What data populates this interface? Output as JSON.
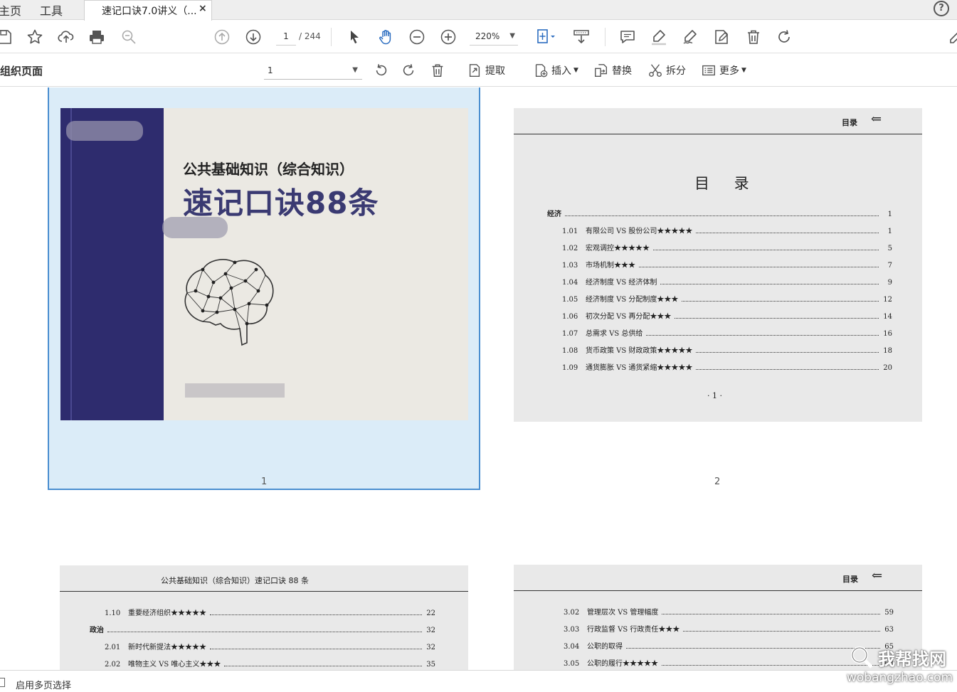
{
  "tabbar": {
    "home_label": "主页",
    "tools_label": "工具",
    "doc_tab_title": "速记口诀7.0讲义（...",
    "close_glyph": "×",
    "help_glyph": "?"
  },
  "toolbar": {
    "current_page": "1",
    "page_total": "/ 244",
    "zoom": "220%",
    "icons": [
      "save-icon",
      "star-icon",
      "upload-icon",
      "print-icon",
      "zoom-out-magnifier-icon",
      "page-up-icon",
      "page-down-icon",
      "select-cursor-icon",
      "hand-icon",
      "zoom-minus-icon",
      "zoom-plus-icon",
      "fit-page-icon",
      "scroll-mode-icon",
      "comment-icon",
      "highlight-icon",
      "sign-icon",
      "edit-page-icon",
      "delete-icon",
      "rotate-icon"
    ]
  },
  "organize": {
    "title": "组织页面",
    "page_select": "1",
    "extract": "提取",
    "insert": "插入",
    "replace": "替换",
    "split": "拆分",
    "more": "更多"
  },
  "pages": {
    "p1_number": "1",
    "p2_number": "2",
    "cover": {
      "subtitle": "公共基础知识（综合知识）",
      "title": "速记口诀88条"
    },
    "toc2": {
      "header": "目录",
      "title": "目 录",
      "section": "经济",
      "section_page": "1",
      "entries": [
        {
          "num": "1.01",
          "text": "有限公司 VS 股份公司★★★★★",
          "page": "1"
        },
        {
          "num": "1.02",
          "text": "宏观调控★★★★★",
          "page": "5"
        },
        {
          "num": "1.03",
          "text": "市场机制★★★",
          "page": "7"
        },
        {
          "num": "1.04",
          "text": "经济制度 VS 经济体制",
          "page": "9"
        },
        {
          "num": "1.05",
          "text": "经济制度 VS 分配制度★★★",
          "page": "12"
        },
        {
          "num": "1.06",
          "text": "初次分配 VS 再分配★★★",
          "page": "14"
        },
        {
          "num": "1.07",
          "text": "总需求 VS 总供给",
          "page": "16"
        },
        {
          "num": "1.08",
          "text": "货币政策 VS 财政政策★★★★★",
          "page": "18"
        },
        {
          "num": "1.09",
          "text": "通货膨胀 VS 通货紧缩★★★★★",
          "page": "20"
        }
      ],
      "footer": "· 1 ·"
    },
    "toc3": {
      "header": "公共基础知识（综合知识）速记口诀 88 条",
      "e1_num": "1.10",
      "e1_text": "重要经济组织★★★★★",
      "e1_page": "22",
      "section": "政治",
      "section_page": "32",
      "e2_num": "2.01",
      "e2_text": "新时代新提法★★★★★",
      "e2_page": "32",
      "e3_num": "2.02",
      "e3_text": "唯物主义 VS 唯心主义★★★",
      "e3_page": "35"
    },
    "toc4": {
      "header": "目录",
      "e1_num": "3.02",
      "e1_text": "管理层次 VS 管理幅度",
      "e1_page": "59",
      "e2_num": "3.03",
      "e2_text": "行政监督 VS 行政责任★★★",
      "e2_page": "63",
      "e3_num": "3.04",
      "e3_text": "公职的取得",
      "e3_page": "65",
      "e4_num": "3.05",
      "e4_text": "公职的履行★★★★★",
      "e4_page": "68"
    }
  },
  "statusbar": {
    "multi_select_label": "启用多页选择"
  },
  "watermark": {
    "cn": "我帮找网",
    "url": "wobangzhao.com"
  },
  "colors": {
    "accent": "#4a8ed0",
    "selection_bg": "#dbecf8",
    "icon_blue": "#2a6cc0",
    "spine": "#2e2c6e"
  }
}
